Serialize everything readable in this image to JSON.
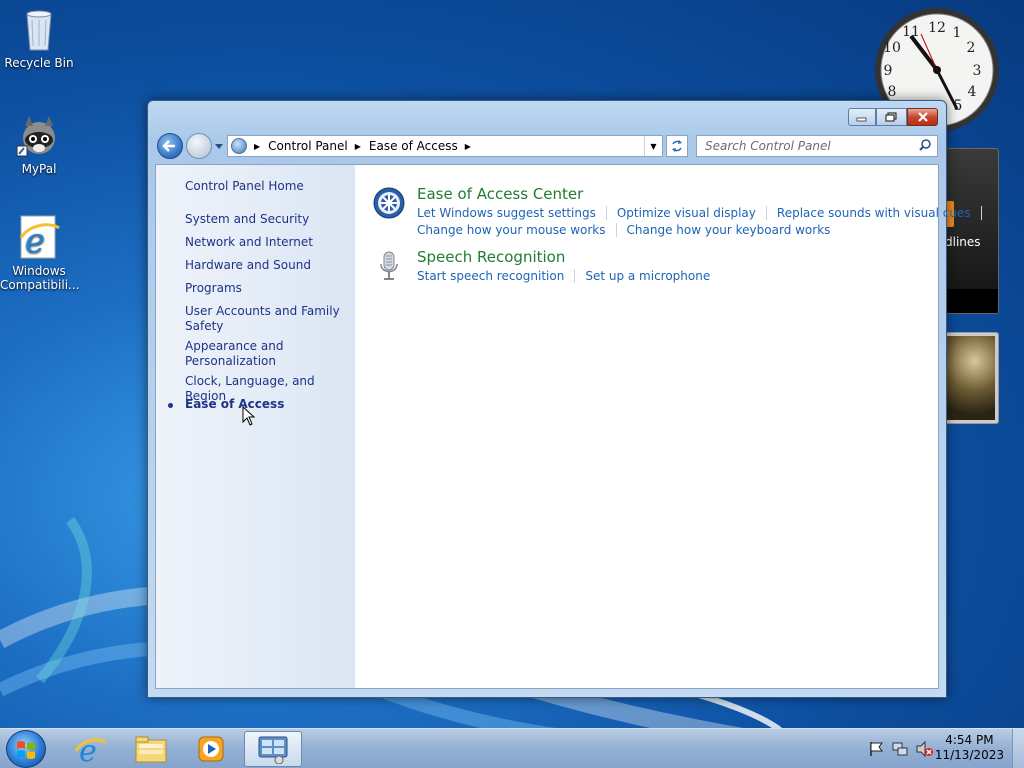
{
  "desktop": {
    "icons": [
      {
        "label": "Recycle Bin",
        "icon": "recycle-bin-icon"
      },
      {
        "label": "MyPal",
        "icon": "raccoon-icon"
      },
      {
        "label": "Windows Compatibili...",
        "icon": "ie-icon"
      }
    ],
    "gadget_headlines_text": "dlines"
  },
  "window": {
    "title": "",
    "breadcrumb": [
      "Control Panel",
      "Ease of Access"
    ],
    "search_placeholder": "Search Control Panel",
    "left_nav": {
      "home": "Control Panel Home",
      "items": [
        "System and Security",
        "Network and Internet",
        "Hardware and Sound",
        "Programs",
        "User Accounts and Family Safety",
        "Appearance and Personalization",
        "Clock, Language, and Region",
        "Ease of Access"
      ],
      "selected_index": 7
    },
    "categories": [
      {
        "title": "Ease of Access Center",
        "icon": "ease-of-access-icon",
        "tasks_row1": [
          "Let Windows suggest settings",
          "Optimize visual display",
          "Replace sounds with visual cues"
        ],
        "tasks_row2": [
          "Change how your mouse works",
          "Change how your keyboard works"
        ]
      },
      {
        "title": "Speech Recognition",
        "icon": "microphone-icon",
        "tasks_row1": [
          "Start speech recognition",
          "Set up a microphone"
        ]
      }
    ]
  },
  "taskbar": {
    "time": "4:54 PM",
    "date": "11/13/2023",
    "pinned": [
      "internet-explorer-icon",
      "explorer-folder-icon",
      "media-player-icon",
      "control-panel-icon"
    ],
    "active_index": 3,
    "tray_icons": [
      "action-center-flag-icon",
      "network-icon",
      "volume-muted-icon"
    ]
  },
  "colors": {
    "link_blue": "#1e64b4",
    "category_green": "#1e7d32",
    "nav_link": "#1e3287"
  }
}
